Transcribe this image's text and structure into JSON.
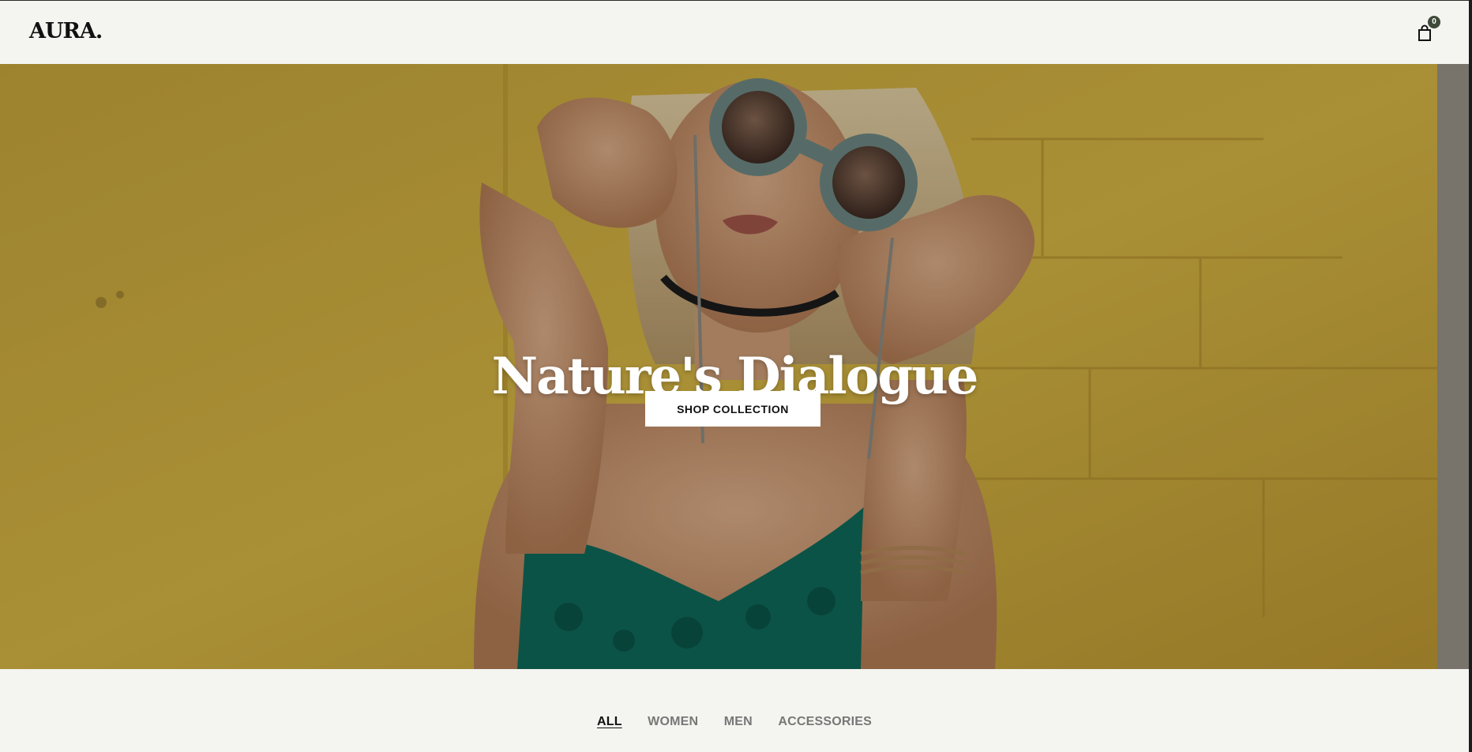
{
  "header": {
    "logo": "AURA.",
    "cart_count": "0",
    "cart_icon": "shopping-bag-icon"
  },
  "hero": {
    "title": "Nature's Dialogue",
    "button_label": "SHOP COLLECTION",
    "background_color": "#c9a93a"
  },
  "filters": {
    "tabs": [
      {
        "label": "ALL",
        "active": true
      },
      {
        "label": "WOMEN",
        "active": false
      },
      {
        "label": "MEN",
        "active": false
      },
      {
        "label": "ACCESSORIES",
        "active": false
      }
    ]
  },
  "colors": {
    "background": "#f4f4f0",
    "badge": "#3e4a3a",
    "text": "#111111",
    "muted": "#777777"
  }
}
